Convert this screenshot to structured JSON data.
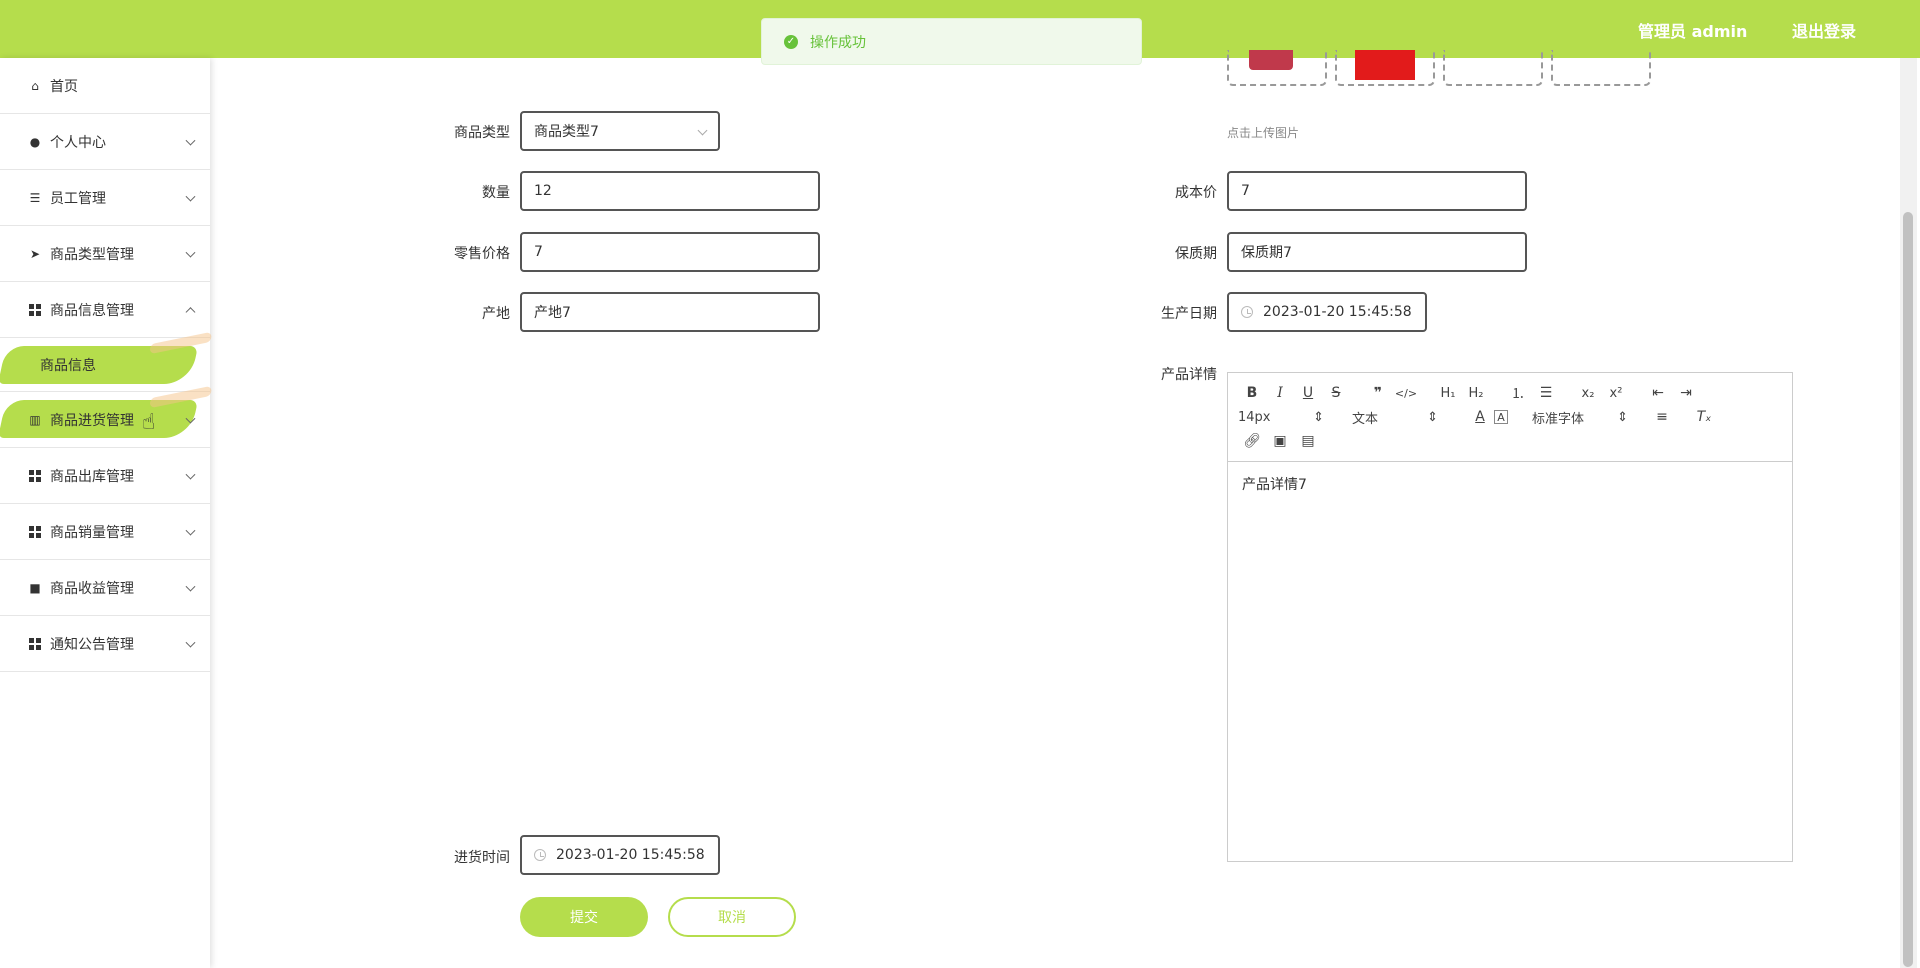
{
  "header": {
    "user_label": "管理员 admin",
    "logout": "退出登录",
    "bg_color": "#b5dd4c"
  },
  "toast": {
    "message": "操作成功"
  },
  "sidebar": {
    "items": [
      {
        "label": "首页",
        "icon": "home-icon"
      },
      {
        "label": "个人中心",
        "icon": "user-icon"
      },
      {
        "label": "员工管理",
        "icon": "list-icon"
      },
      {
        "label": "商品类型管理",
        "icon": "send-icon"
      },
      {
        "label": "商品信息管理",
        "icon": "grid-icon"
      },
      {
        "label": "商品信息",
        "icon": ""
      },
      {
        "label": "商品进货管理",
        "icon": "building-icon"
      },
      {
        "label": "商品出库管理",
        "icon": "grid-icon"
      },
      {
        "label": "商品销量管理",
        "icon": "grid-icon"
      },
      {
        "label": "商品收益管理",
        "icon": "briefcase-icon"
      },
      {
        "label": "通知公告管理",
        "icon": "grid-icon"
      }
    ]
  },
  "form": {
    "product_type": {
      "label": "商品类型",
      "value": "商品类型7"
    },
    "quantity": {
      "label": "数量",
      "value": "12"
    },
    "retail_price": {
      "label": "零售价格",
      "value": "7"
    },
    "origin": {
      "label": "产地",
      "value": "产地7"
    },
    "cost_price": {
      "label": "成本价",
      "value": "7"
    },
    "shelf_life": {
      "label": "保质期",
      "value": "保质期7"
    },
    "production_date": {
      "label": "生产日期",
      "value": "2023-01-20 15:45:58"
    },
    "detail": {
      "label": "产品详情",
      "value": "产品详情7"
    },
    "purchase_time": {
      "label": "进货时间",
      "value": "2023-01-20 15:45:58"
    },
    "upload_hint": "点击上传图片",
    "submit": "提交",
    "cancel": "取消"
  },
  "editor": {
    "font_size": "14px",
    "text_style": "文本",
    "font_family": "标准字体"
  }
}
